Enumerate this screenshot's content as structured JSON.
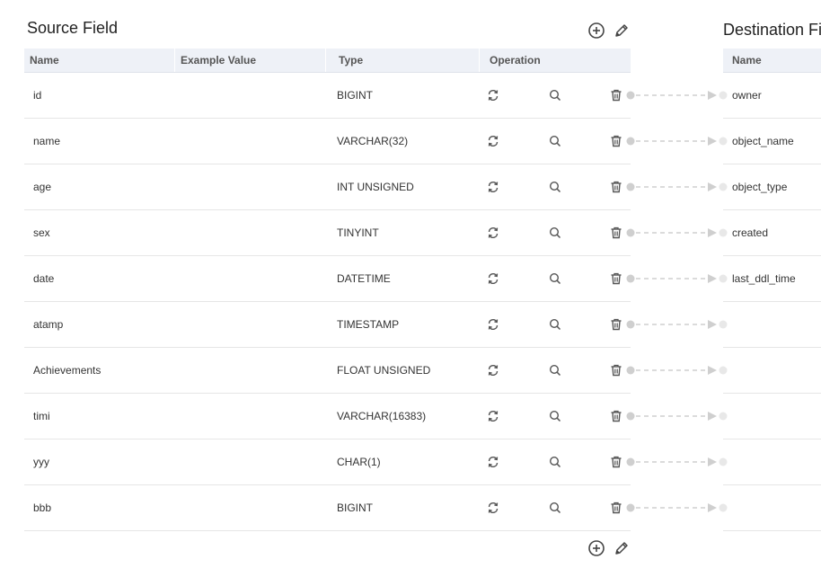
{
  "source": {
    "title": "Source Field",
    "columns": [
      "Name",
      "Example Value",
      "Type",
      "Operation"
    ],
    "rows": [
      {
        "name": "id",
        "example": "",
        "type": "BIGINT"
      },
      {
        "name": "name",
        "example": "",
        "type": "VARCHAR(32)"
      },
      {
        "name": "age",
        "example": "",
        "type": "INT UNSIGNED"
      },
      {
        "name": "sex",
        "example": "",
        "type": "TINYINT"
      },
      {
        "name": "date",
        "example": "",
        "type": "DATETIME"
      },
      {
        "name": "atamp",
        "example": "",
        "type": "TIMESTAMP"
      },
      {
        "name": "Achievements",
        "example": "",
        "type": "FLOAT UNSIGNED"
      },
      {
        "name": "timi",
        "example": "",
        "type": "VARCHAR(16383)"
      },
      {
        "name": "yyy",
        "example": "",
        "type": "CHAR(1)"
      },
      {
        "name": "bbb",
        "example": "",
        "type": "BIGINT"
      }
    ],
    "toolbar_icons": [
      "add-circle-icon",
      "edit-pencil-icon"
    ],
    "row_operation_icons": [
      "sync-icon",
      "search-icon",
      "delete-icon"
    ]
  },
  "destination": {
    "title": "Destination Fi",
    "columns": [
      "Name"
    ],
    "rows": [
      {
        "name": "owner"
      },
      {
        "name": "object_name"
      },
      {
        "name": "object_type"
      },
      {
        "name": "created"
      },
      {
        "name": "last_ddl_time"
      },
      {
        "name": ""
      },
      {
        "name": ""
      },
      {
        "name": ""
      },
      {
        "name": ""
      },
      {
        "name": ""
      }
    ]
  },
  "colors": {
    "header_bg": "#eef1f7",
    "connector": "#cfcfcf",
    "icon": "#555555",
    "row_border": "#e6e6e6"
  }
}
